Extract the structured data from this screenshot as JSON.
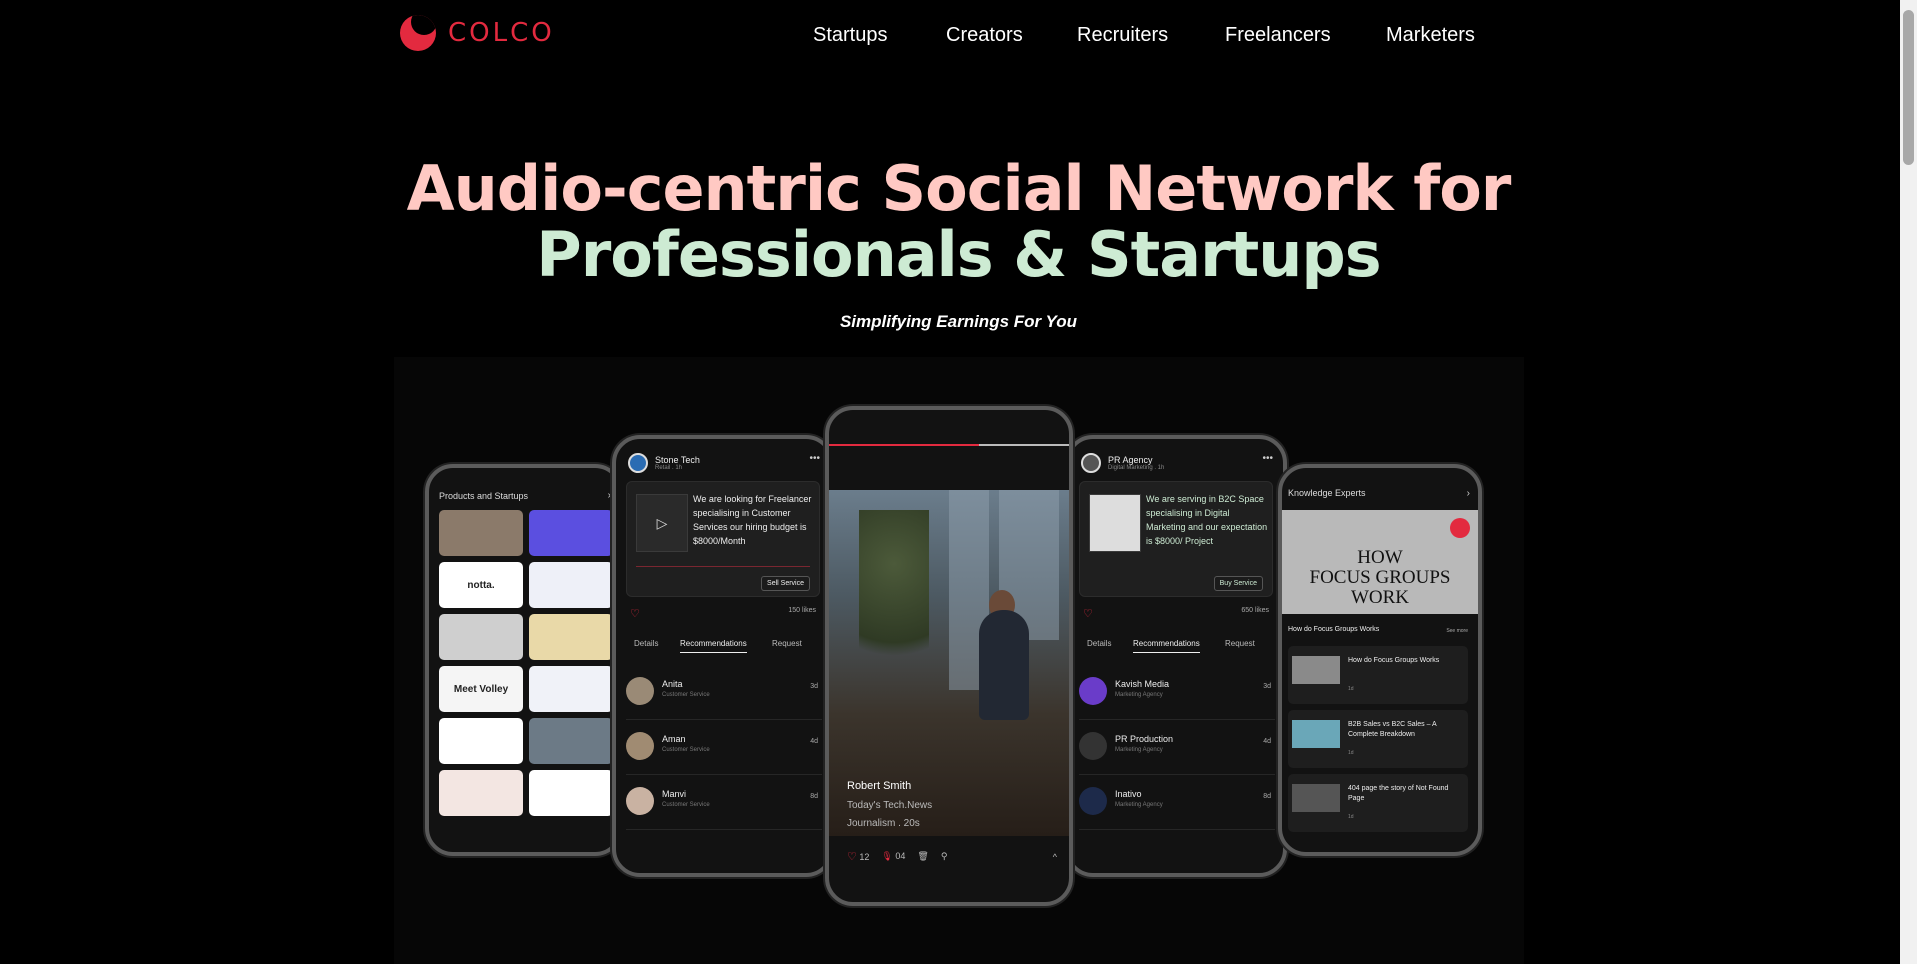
{
  "brand": {
    "name": "COLCO",
    "color": "#e32a3f"
  },
  "nav": {
    "items": [
      "Startups",
      "Creators",
      "Recruiters",
      "Freelancers",
      "Marketers"
    ]
  },
  "hero": {
    "line1": "Audio-centric Social Network for",
    "line2": "Professionals & Startups",
    "tagline": "Simplifying Earnings For You",
    "line1_color": "#ffc9c3",
    "line2_color": "#cdebd3"
  },
  "phones": {
    "a": {
      "title": "Products and Startups",
      "thumbs": [
        "",
        "",
        "notta.",
        "",
        "",
        "",
        "Meet Volley",
        "",
        "",
        "",
        "",
        ""
      ]
    },
    "b": {
      "org": "Stone Tech",
      "org_sub": "Retail . 1h",
      "post_text": "We are looking for Freelancer specialising in Customer Services our hiring budget is $8000/Month",
      "button": "Sell Service",
      "likes": "150 likes",
      "tabs": [
        "Details",
        "Recommendations",
        "Request"
      ],
      "rows": [
        {
          "name": "Anita",
          "sub": "Customer Service",
          "time": "3d"
        },
        {
          "name": "Aman",
          "sub": "Customer Service",
          "time": "4d"
        },
        {
          "name": "Manvi",
          "sub": "Customer Service",
          "time": "8d"
        }
      ]
    },
    "c": {
      "name": "Robert Smith",
      "subtitle": "Today's Tech.News",
      "meta": "Journalism . 20s",
      "likes": "12",
      "mics": "04"
    },
    "d": {
      "org": "PR Agency",
      "org_sub": "Digital Marketing . 1h",
      "post_text": "We are serving in B2C Space specialising in Digital Marketing and our expectation is $8000/ Project",
      "button": "Buy Service",
      "likes": "650 likes",
      "tabs": [
        "Details",
        "Recommendations",
        "Request"
      ],
      "rows": [
        {
          "name": "Kavish Media",
          "sub": "Marketing Agency",
          "time": "3d"
        },
        {
          "name": "PR Production",
          "sub": "Marketing Agency",
          "time": "4d"
        },
        {
          "name": "Inativo",
          "sub": "Marketing Agency",
          "time": "8d"
        }
      ]
    },
    "e": {
      "title": "Knowledge Experts",
      "hero_line1": "HOW",
      "hero_line2": "FOCUS GROUPS",
      "hero_line3": "WORK",
      "section": "How do Focus Groups Works",
      "more": "See more",
      "items": [
        {
          "title": "How do Focus Groups Works",
          "sub": "1d"
        },
        {
          "title": "B2B Sales vs B2C Sales – A Complete Breakdown",
          "sub": "1d"
        },
        {
          "title": "404 page the story of Not Found Page",
          "sub": "1d"
        }
      ]
    }
  }
}
